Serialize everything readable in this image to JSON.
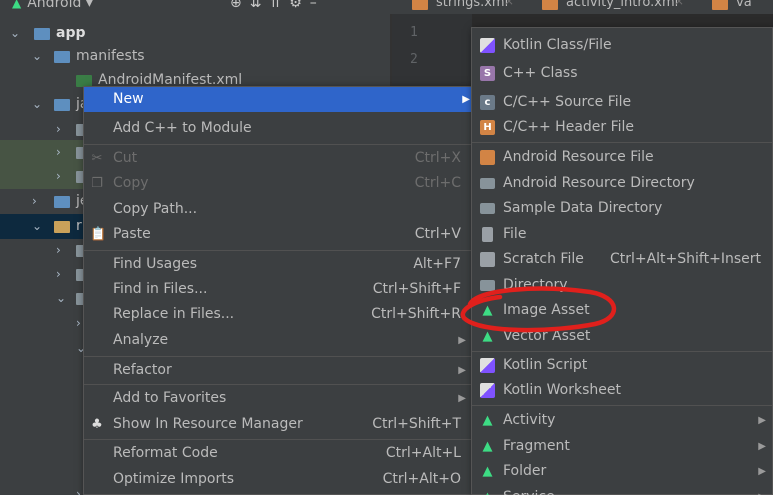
{
  "toolbar": {
    "project_label": "Android",
    "icons": [
      "android-logo-icon",
      "dropdown-icon",
      "target-icon",
      "collapse-icon",
      "expand-icon",
      "gear-icon",
      "minimize-icon"
    ]
  },
  "tabs": [
    {
      "label": "strings.xml",
      "close": "×"
    },
    {
      "label": "activity_intro.xml",
      "close": "×"
    },
    {
      "label": "va",
      "close": ""
    }
  ],
  "tree": {
    "rows": [
      {
        "label": "app",
        "icon": "module-folder-icon"
      },
      {
        "label": "manifests",
        "icon": "folder-icon"
      },
      {
        "label": "AndroidManifest.xml",
        "icon": "manifest-file-icon"
      },
      {
        "label": "ja",
        "icon": "folder-icon"
      },
      {
        "label": "je",
        "icon": "folder-icon"
      },
      {
        "label": "r",
        "icon": "res-folder-icon"
      }
    ]
  },
  "gutter": {
    "lines": [
      "1",
      "2"
    ]
  },
  "context_menu": {
    "items": [
      {
        "label": "New",
        "shortcut": "",
        "submenu": true
      },
      {
        "label": "Add C++ to Module",
        "shortcut": ""
      },
      {
        "label": "Cut",
        "shortcut": "Ctrl+X",
        "disabled": true,
        "icon": "scissors-icon"
      },
      {
        "label": "Copy",
        "shortcut": "Ctrl+C",
        "disabled": true,
        "icon": "copy-icon"
      },
      {
        "label": "Copy Path...",
        "shortcut": ""
      },
      {
        "label": "Paste",
        "shortcut": "Ctrl+V",
        "icon": "clipboard-icon"
      },
      {
        "label": "Find Usages",
        "shortcut": "Alt+F7"
      },
      {
        "label": "Find in Files...",
        "shortcut": "Ctrl+Shift+F"
      },
      {
        "label": "Replace in Files...",
        "shortcut": "Ctrl+Shift+R"
      },
      {
        "label": "Analyze",
        "shortcut": "",
        "submenu": true
      },
      {
        "label": "Refactor",
        "shortcut": "",
        "submenu": true
      },
      {
        "label": "Add to Favorites",
        "shortcut": "",
        "submenu": true
      },
      {
        "label": "Show In Resource Manager",
        "shortcut": "Ctrl+Shift+T",
        "icon": "resource-manager-icon"
      },
      {
        "label": "Reformat Code",
        "shortcut": "Ctrl+Alt+L"
      },
      {
        "label": "Optimize Imports",
        "shortcut": "Ctrl+Alt+O"
      }
    ]
  },
  "new_submenu": {
    "items": [
      {
        "label": "Kotlin Class/File",
        "icon": "kotlin-class-icon"
      },
      {
        "label": "C++ Class",
        "icon": "cpp-class-icon"
      },
      {
        "label": "C/C++ Source File",
        "icon": "cpp-source-icon"
      },
      {
        "label": "C/C++ Header File",
        "icon": "cpp-header-icon"
      },
      {
        "label": "Android Resource File",
        "icon": "android-resource-file-icon"
      },
      {
        "label": "Android Resource Directory",
        "icon": "folder-icon"
      },
      {
        "label": "Sample Data Directory",
        "icon": "folder-icon"
      },
      {
        "label": "File",
        "icon": "file-icon"
      },
      {
        "label": "Scratch File",
        "shortcut": "Ctrl+Alt+Shift+Insert",
        "icon": "scratch-file-icon"
      },
      {
        "label": "Directory",
        "icon": "folder-icon"
      },
      {
        "label": "Image Asset",
        "icon": "android-icon",
        "annotated": true
      },
      {
        "label": "Vector Asset",
        "icon": "android-icon"
      },
      {
        "label": "Kotlin Script",
        "icon": "kotlin-script-icon"
      },
      {
        "label": "Kotlin Worksheet",
        "icon": "kotlin-worksheet-icon"
      },
      {
        "label": "Activity",
        "icon": "android-icon",
        "submenu": true
      },
      {
        "label": "Fragment",
        "icon": "android-icon",
        "submenu": true
      },
      {
        "label": "Folder",
        "icon": "android-icon",
        "submenu": true
      },
      {
        "label": "Service",
        "icon": "android-icon",
        "submenu": true
      }
    ]
  },
  "annotation": {
    "color": "#e0201c",
    "target": "Image Asset"
  }
}
